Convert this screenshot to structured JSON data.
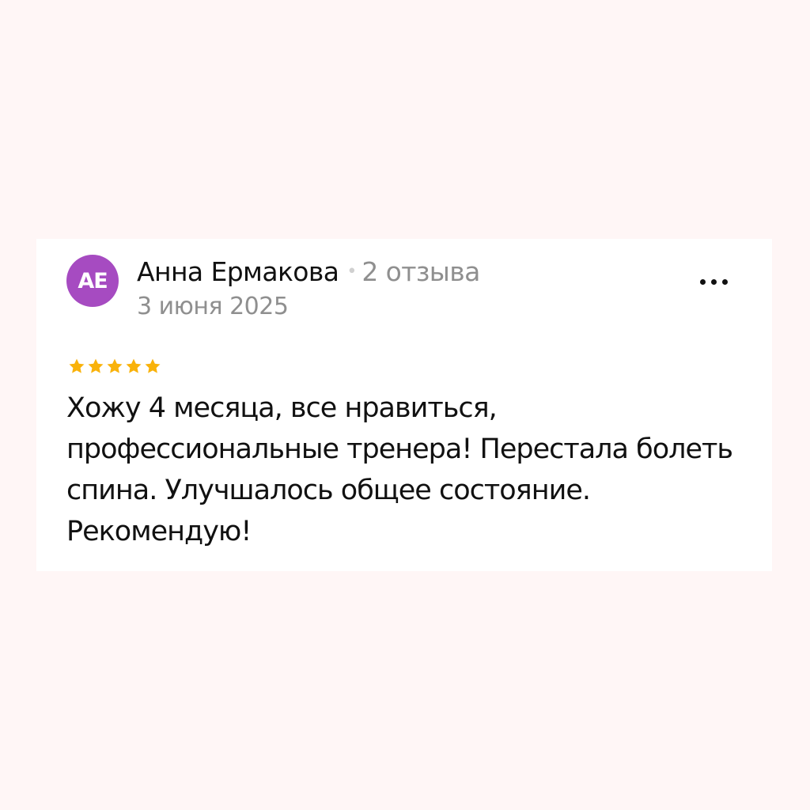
{
  "review": {
    "avatar_initials": "AE",
    "avatar_color": "#a64bc1",
    "author_name": "Анна Ермакова",
    "separator": "•",
    "review_count": "2 отзыва",
    "date": "3 июня 2025",
    "rating": 5,
    "rating_max": 5,
    "star_color": "#f9b20a",
    "text": "Хожу 4 месяца, все нравиться, профессиональные тренера! Перестала болеть спина. Улучшалось общее состояние. Рекомендую!"
  },
  "icons": {
    "more": "more-dots-icon",
    "star": "star-icon"
  }
}
